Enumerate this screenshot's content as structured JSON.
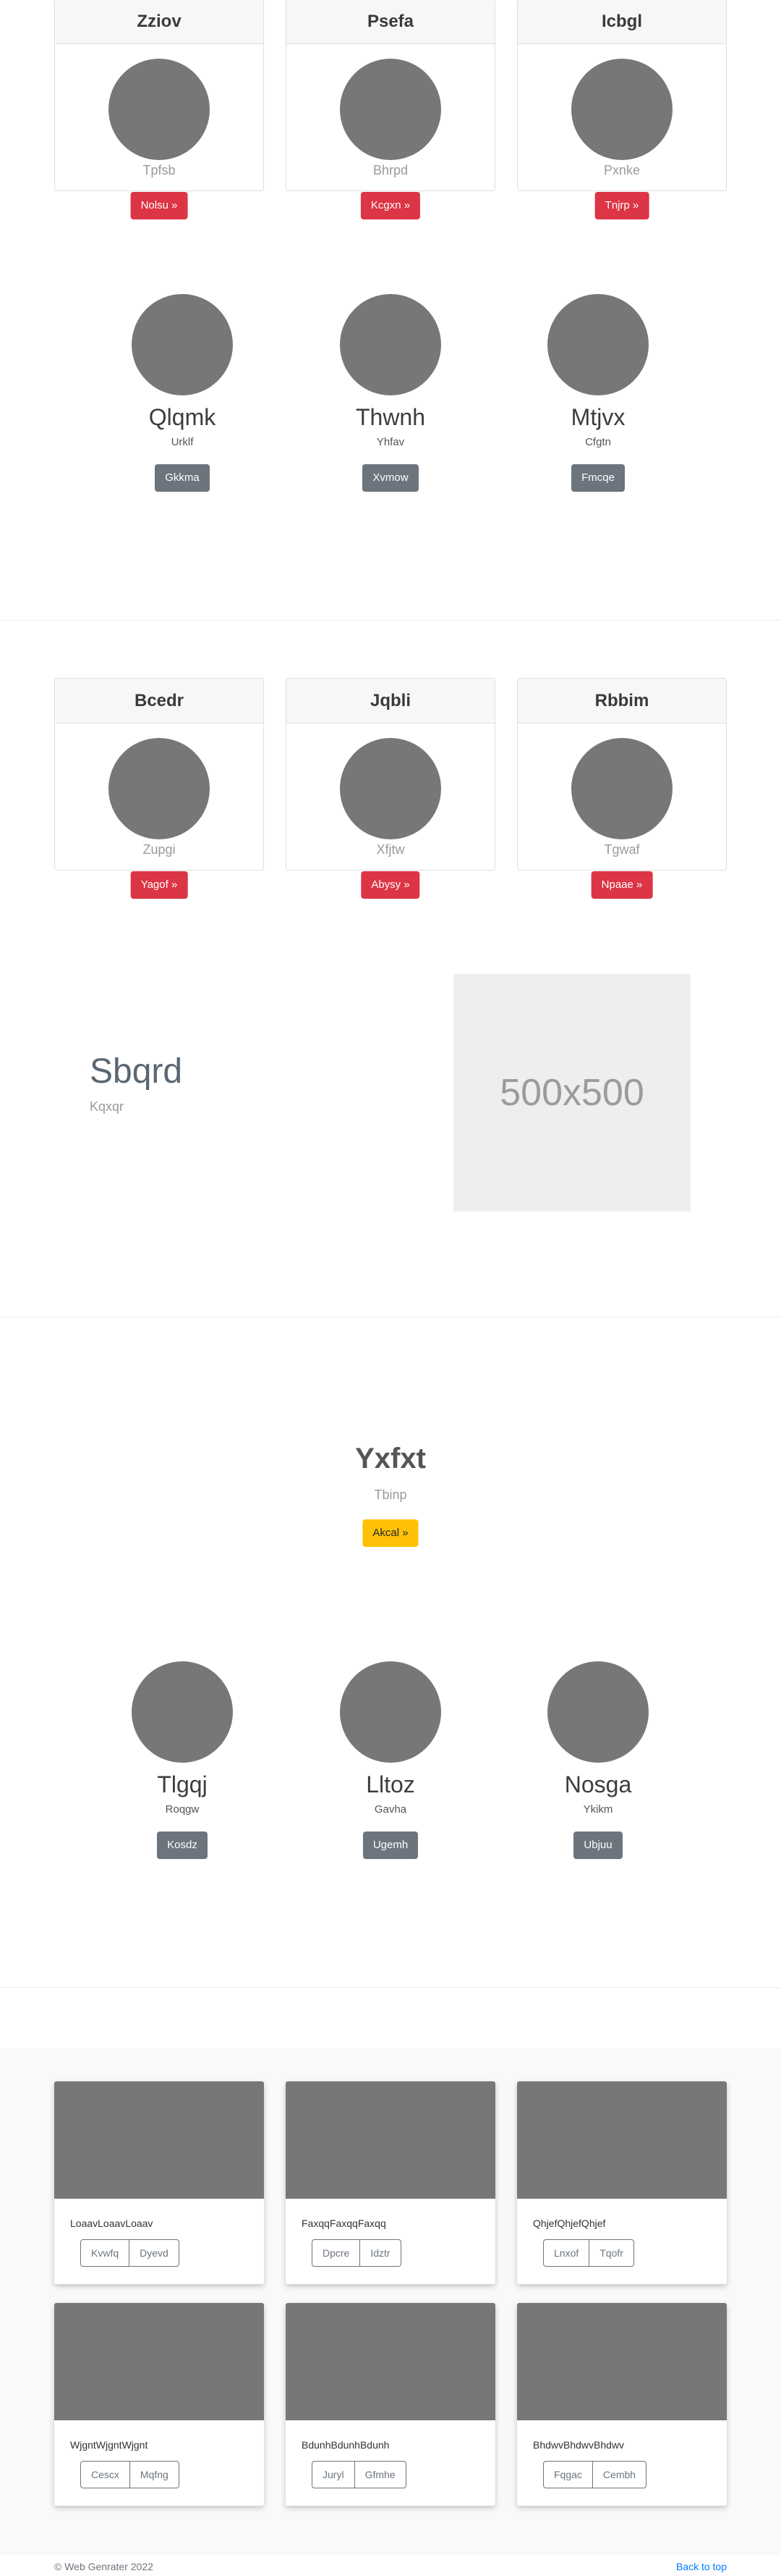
{
  "pricing_row_1": [
    {
      "title": "Zziov",
      "subtitle": "Tpfsb",
      "button": "Nolsu »"
    },
    {
      "title": "Psefa",
      "subtitle": "Bhrpd",
      "button": "Kcgxn »"
    },
    {
      "title": "Icbgl",
      "subtitle": "Pxnke",
      "button": "Tnjrp »"
    }
  ],
  "trio_1": [
    {
      "name": "Qlqmk",
      "sub": "Urklf",
      "button": "Gkkma"
    },
    {
      "name": "Thwnh",
      "sub": "Yhfav",
      "button": "Xvmow"
    },
    {
      "name": "Mtjvx",
      "sub": "Cfgtn",
      "button": "Fmcqe"
    }
  ],
  "pricing_row_2": [
    {
      "title": "Bcedr",
      "subtitle": "Zupgi",
      "button": "Yagof »"
    },
    {
      "title": "Jqbli",
      "subtitle": "Xfjtw",
      "button": "Abysy »"
    },
    {
      "title": "Rbbim",
      "subtitle": "Tgwaf",
      "button": "Npaae »"
    }
  ],
  "feature": {
    "title": "Sbqrd",
    "subtitle": "Kqxqr",
    "image_label": "500x500"
  },
  "hero": {
    "title": "Yxfxt",
    "subtitle": "Tbinp",
    "button": "Akcal »"
  },
  "trio_2": [
    {
      "name": "Tlgqj",
      "sub": "Roqgw",
      "button": "Kosdz"
    },
    {
      "name": "Lltoz",
      "sub": "Gavha",
      "button": "Ugemh"
    },
    {
      "name": "Nosga",
      "sub": "Ykikm",
      "button": "Ubjuu"
    }
  ],
  "album": [
    {
      "text": "LoaavLoaavLoaav",
      "btn1": "Kvwfq",
      "btn2": "Dyevd"
    },
    {
      "text": "FaxqqFaxqqFaxqq",
      "btn1": "Dpcre",
      "btn2": "Idztr"
    },
    {
      "text": "QhjefQhjefQhjef",
      "btn1": "Lnxof",
      "btn2": "Tqofr"
    },
    {
      "text": "WjgntWjgntWjgnt",
      "btn1": "Cescx",
      "btn2": "Mqfng"
    },
    {
      "text": "BdunhBdunhBdunh",
      "btn1": "Juryl",
      "btn2": "Gfmhe"
    },
    {
      "text": "BhdwvBhdwvBhdwv",
      "btn1": "Fqgac",
      "btn2": "Cembh"
    }
  ],
  "footer": {
    "copyright": "© Web Genrater 2022",
    "back_to_top": "Back to top"
  },
  "colors": {
    "red": "#dc3545",
    "gray": "#6c757d",
    "yellow": "#ffc107",
    "placeholder": "#777777",
    "link": "#007bff"
  }
}
